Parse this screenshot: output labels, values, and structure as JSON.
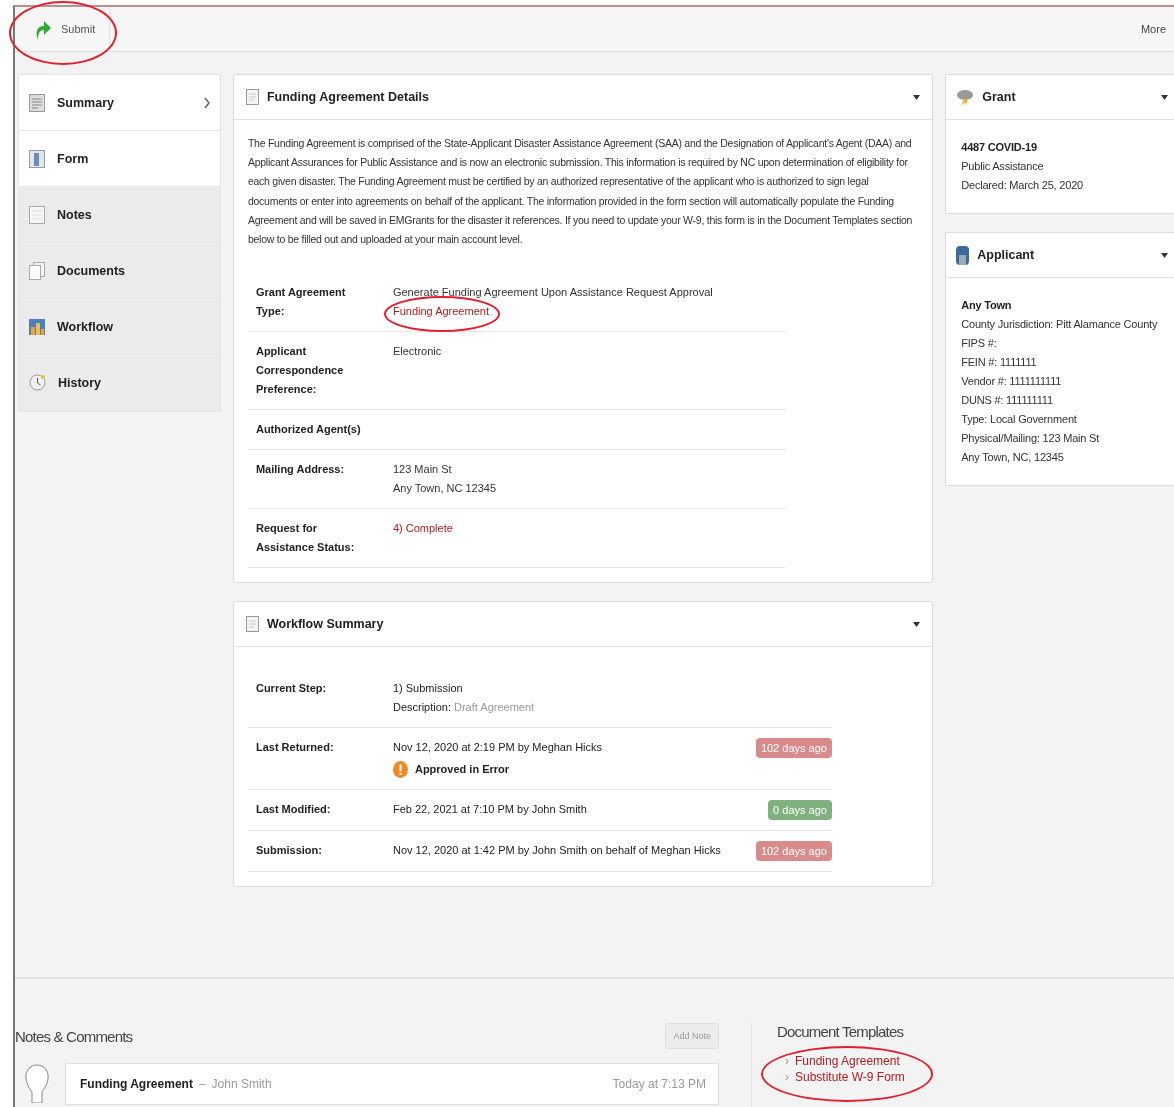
{
  "toolbar": {
    "submit": {
      "label": "Submit",
      "circled": true
    },
    "more": "More"
  },
  "sidebar": {
    "items": [
      {
        "label": "Summary",
        "selected": true,
        "shaded": false
      },
      {
        "label": "Form",
        "selected": false,
        "shaded": false
      },
      {
        "label": "Notes",
        "selected": false,
        "shaded": true
      },
      {
        "label": "Documents",
        "selected": false,
        "shaded": true
      },
      {
        "label": "Workflow",
        "selected": false,
        "shaded": true
      },
      {
        "label": "History",
        "selected": false,
        "shaded": true
      }
    ]
  },
  "details": {
    "title": "Funding Agreement Details",
    "intro": "The Funding Agreement is comprised of the State-Applicant Disaster Assistance Agreement (SAA) and the Designation of Applicant's Agent (DAA) and Applicant Assurances for Public Assistance and is now an electronic submission. This information is required by NC upon determination of eligibility for each given disaster. The Funding Agreement must be certified by an authorized representative of the applicant who is authorized to sign legal documents or enter into agreements on behalf of the applicant. The information provided in the form section will automatically populate the Funding Agreement and will be saved in EMGrants for the disaster it references. If you need to update your W-9, this form is in the Document Templates section below to be filled out and uploaded at your main account level.",
    "rows": [
      {
        "label": "Grant Agreement Type:",
        "values": [
          {
            "kind": "text",
            "text": "Generate Funding Agreement Upon Assistance Request Approval"
          },
          {
            "kind": "link",
            "text": "Funding Agreement",
            "circled": true
          }
        ]
      },
      {
        "label": "Applicant Correspondence Preference:",
        "values": [
          {
            "kind": "text",
            "text": "Electronic"
          }
        ]
      },
      {
        "label": "Authorized Agent(s)",
        "values": []
      },
      {
        "label": "Mailing Address:",
        "values": [
          {
            "kind": "text",
            "text": "123 Main St"
          },
          {
            "kind": "text",
            "text": "Any Town, NC  12345"
          }
        ]
      },
      {
        "label": "Request for Assistance Status:",
        "values": [
          {
            "kind": "status",
            "text": "4) Complete"
          }
        ]
      }
    ]
  },
  "workflow": {
    "title": "Workflow Summary",
    "rows": [
      {
        "label": "Current Step:",
        "value": "1) Submission",
        "description_label": "Description:",
        "description": "Draft Agreement"
      },
      {
        "label": "Last Returned:",
        "value": "Nov 12, 2020 at 2:19 PM by Meghan Hicks",
        "note": "Approved in Error",
        "badge": {
          "text": "102 days ago",
          "color": "#d98b8b"
        }
      },
      {
        "label": "Last Modified:",
        "value": "Feb 22, 2021 at 7:10 PM by John Smith",
        "badge": {
          "text": "0 days ago",
          "color": "#7fb07f"
        }
      },
      {
        "label": "Submission:",
        "value": "Nov 12, 2020 at 1:42 PM by John Smith on behalf of Meghan Hicks",
        "badge": {
          "text": "102 days ago",
          "color": "#d98b8b"
        }
      }
    ]
  },
  "grant": {
    "title": "Grant",
    "name": "4487 COVID-19",
    "lines": [
      "Public Assistance",
      "Declared: March 25, 2020"
    ]
  },
  "applicant": {
    "title": "Applicant",
    "name": "Any Town",
    "lines": [
      "County Jurisdiction: Pitt Alamance County",
      "FIPS #:",
      "FEIN #: 1111111",
      "Vendor #: 1111111111",
      "DUNS #: 111111111",
      "Type: Local Government",
      "Physical/Mailing: 123 Main St",
      "Any Town, NC, 12345"
    ]
  },
  "notes": {
    "title": "Notes & Comments",
    "add_button": "Add Note",
    "comments": [
      {
        "title": "Funding Agreement",
        "separator": "–",
        "author": "John Smith",
        "time": "Today at 7:13 PM"
      }
    ]
  },
  "templates": {
    "title": "Document Templates",
    "circled": true,
    "links": [
      {
        "text": "Funding Agreement",
        "marker": "›"
      },
      {
        "text": "Substitute W-9 Form",
        "marker": "›"
      }
    ]
  }
}
